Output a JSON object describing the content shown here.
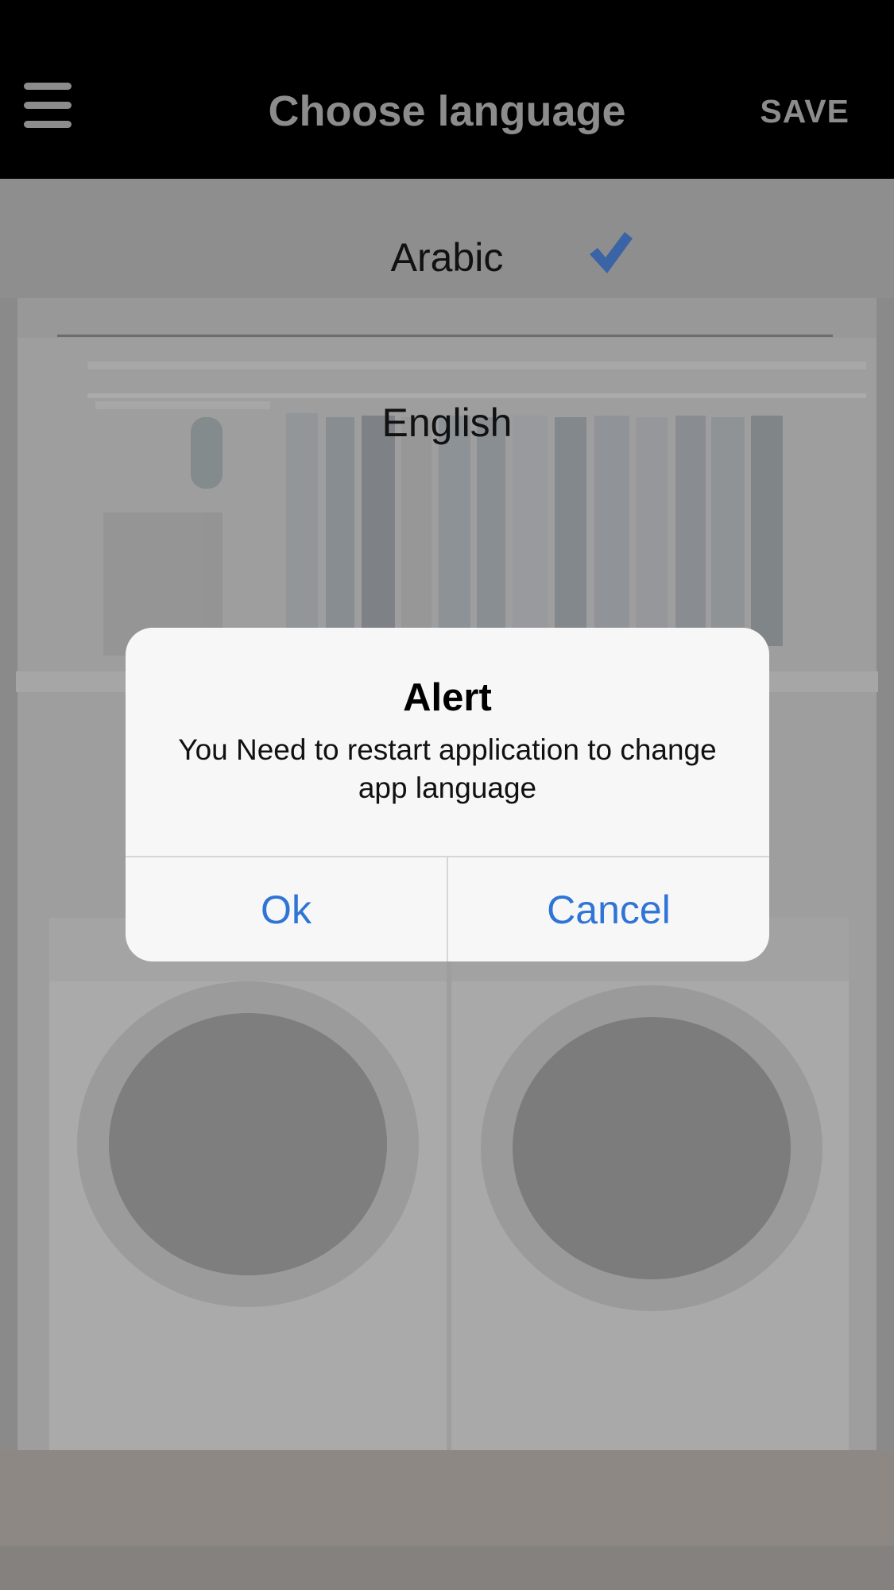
{
  "navbar": {
    "title": "Choose language",
    "save_label": "SAVE"
  },
  "languages": [
    {
      "label": "Arabic",
      "selected": true
    },
    {
      "label": "English",
      "selected": false
    }
  ],
  "alert": {
    "title": "Alert",
    "message": "You Need to restart application to change app language",
    "ok_label": "Ok",
    "cancel_label": "Cancel"
  },
  "colors": {
    "navbar_bg": "#000000",
    "nav_text": "#8c8c8c",
    "accent_blue": "#2f74d6",
    "checkmark": "#3a64a6",
    "dialog_bg": "#f7f7f7"
  },
  "icons": {
    "menu": "hamburger-icon",
    "selected": "checkmark-icon"
  }
}
